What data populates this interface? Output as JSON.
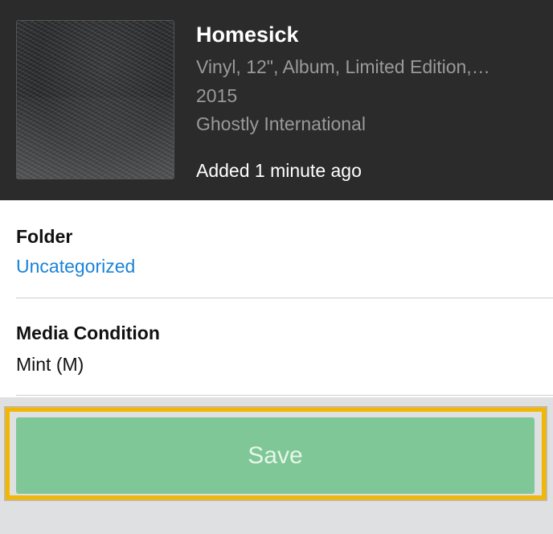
{
  "release": {
    "title": "Homesick",
    "format": "Vinyl, 12\", Album, Limited Edition,…",
    "year": "2015",
    "label": "Ghostly International",
    "added": "Added 1 minute ago"
  },
  "folder": {
    "label": "Folder",
    "value": "Uncategorized"
  },
  "media_condition": {
    "label": "Media Condition",
    "value": "Mint (M)"
  },
  "actions": {
    "save_label": "Save"
  },
  "colors": {
    "header_bg": "#2b2b2b",
    "link": "#1a83d8",
    "save_button": "#7fc796",
    "highlight": "#f2b705"
  }
}
